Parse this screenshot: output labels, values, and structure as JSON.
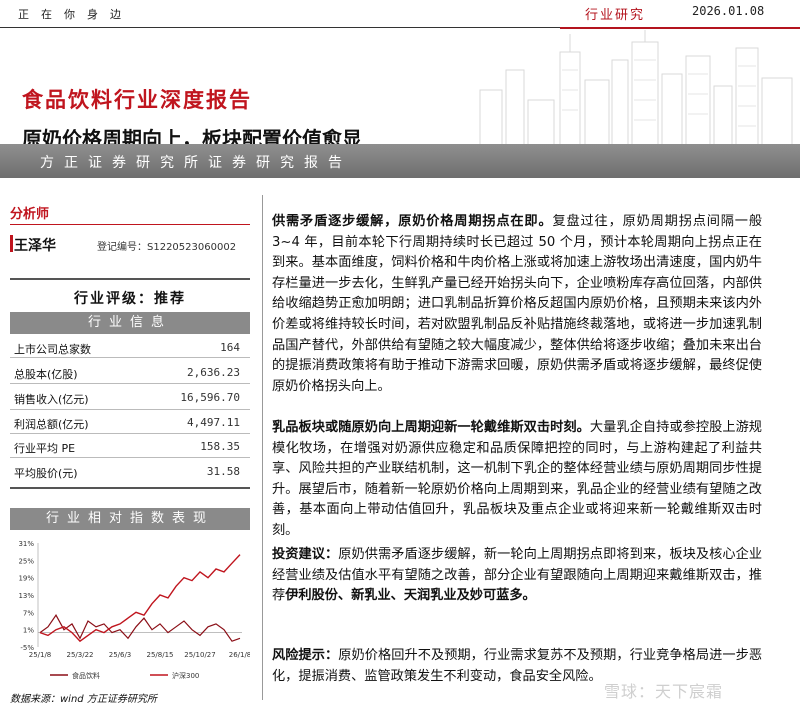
{
  "header": {
    "slogan": "正在你身边",
    "tag": "行业研究",
    "date": "2026.01.08"
  },
  "banner": {
    "title": "食品饮料行业深度报告",
    "subtitle": "原奶价格周期向上，板块配置价值愈显",
    "strip": "方正证券研究所证券研究报告"
  },
  "analyst": {
    "heading": "分析师",
    "name": "王泽华",
    "reg": "登记编号：S1220523060002"
  },
  "rating": "行业评级：推荐",
  "info": {
    "heading": "行业信息",
    "rows": [
      {
        "k": "上市公司总家数",
        "v": "164"
      },
      {
        "k": "总股本(亿股)",
        "v": "2,636.23"
      },
      {
        "k": "销售收入(亿元)",
        "v": "16,596.70"
      },
      {
        "k": "利润总额(亿元)",
        "v": "4,497.11"
      },
      {
        "k": "行业平均 PE",
        "v": "158.35"
      },
      {
        "k": "平均股价(元)",
        "v": "31.58"
      }
    ]
  },
  "chart_heading": "行业相对指数表现",
  "chart_data": {
    "type": "line",
    "x": [
      "25/1/8",
      "25/3/22",
      "25/6/3",
      "25/8/15",
      "25/10/27",
      "26/1/8"
    ],
    "ylim": [
      -5,
      31
    ],
    "yticks": [
      "31%",
      "25%",
      "19%",
      "13%",
      "7%",
      "1%",
      "-5%"
    ],
    "series": [
      {
        "name": "食品饮料",
        "color": "#b4141e",
        "values": [
          0,
          2,
          6,
          1,
          3,
          -2,
          4,
          2,
          3,
          0,
          1,
          -2,
          2,
          5,
          1,
          3,
          0,
          2,
          4,
          1,
          -1,
          2,
          3,
          1,
          -3,
          -2
        ]
      },
      {
        "name": "沪深300",
        "color": "#c0151e",
        "values": [
          0,
          -1,
          1,
          2,
          0,
          -3,
          -1,
          1,
          0,
          2,
          3,
          5,
          7,
          6,
          10,
          13,
          12,
          16,
          19,
          18,
          21,
          19,
          22,
          21,
          24,
          27
        ]
      }
    ]
  },
  "source": "数据来源：wind 方正证券研究所",
  "paragraphs": [
    {
      "bold": "供需矛盾逐步缓解，原奶价格周期拐点在即。",
      "text": "复盘过往，原奶周期拐点间隔一般 3~4 年，目前本轮下行周期持续时长已超过 50 个月，预计本轮周期向上拐点正在到来。基本面维度，饲料价格和牛肉价格上涨或将加速上游牧场出清速度，国内奶牛存栏量进一步去化，生鲜乳产量已经开始拐头向下，企业喷粉库存高位回落，内部供给收缩趋势正愈加明朗；进口乳制品折算价格反超国内原奶价格，且预期未来该内外价差或将维持较长时间，若对欧盟乳制品反补贴措施终裁落地，或将进一步加速乳制品国产替代，外部供给有望随之较大幅度减少，整体供给将逐步收缩；叠加未来出台的提振消费政策将有助于推动下游需求回暖，原奶供需矛盾或将逐步缓解，最终促使原奶价格拐头向上。"
    },
    {
      "bold": "乳品板块或随原奶向上周期迎新一轮戴维斯双击时刻。",
      "text": "大量乳企自持或参控股上游规模化牧场，在增强对奶源供应稳定和品质保障把控的同时，与上游构建起了利益共享、风险共担的产业联结机制，这一机制下乳企的整体经营业绩与原奶周期同步性提升。展望后市，随着新一轮原奶价格向上周期到来，乳品企业的经营业绩有望随之改善，基本面向上带动估值回升，乳品板块及重点企业或将迎来新一轮戴维斯双击时刻。"
    },
    {
      "bold": "投资建议：",
      "text": "原奶供需矛盾逐步缓解，新一轮向上周期拐点即将到来，板块及核心企业经营业绩及估值水平有望随之改善，部分企业有望跟随向上周期迎来戴维斯双击，推荐",
      "bold2": "伊利股份、新乳业、天润乳业及妙可蓝多。"
    },
    {
      "bold": "风险提示：",
      "text": "原奶价格回升不及预期，行业需求复苏不及预期，行业竞争格局进一步恶化，提振消费、监管政策发生不利变动，食品安全风险。"
    }
  ],
  "watermark": "雪球：天下宸霜"
}
